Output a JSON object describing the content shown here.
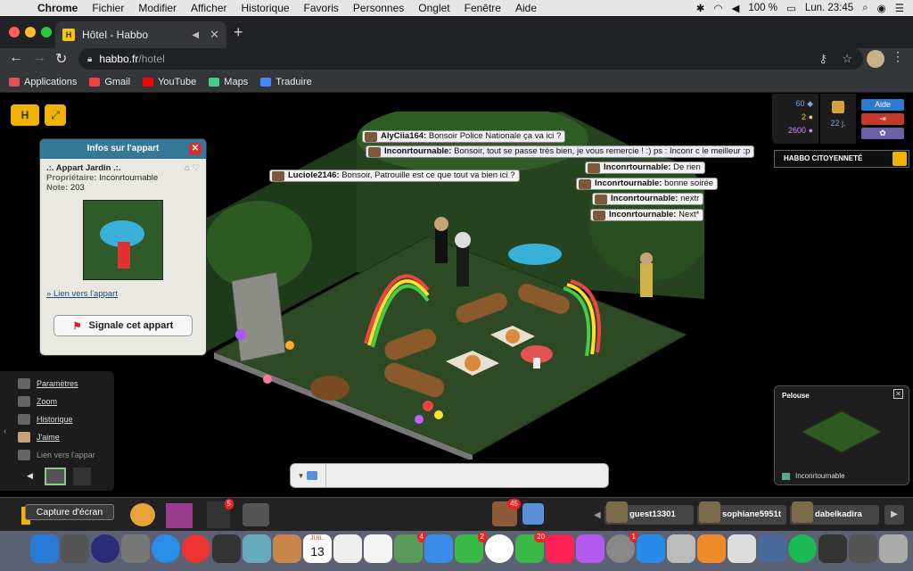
{
  "menubar": {
    "app": "Chrome",
    "items": [
      "Fichier",
      "Modifier",
      "Afficher",
      "Historique",
      "Favoris",
      "Personnes",
      "Onglet",
      "Fenêtre",
      "Aide"
    ],
    "battery": "100 %",
    "clock": "Lun. 23:45"
  },
  "browser": {
    "tab_title": "Hôtel - Habbo",
    "url_host": "habbo.fr",
    "url_path": "/hotel",
    "bookmarks": [
      "Applications",
      "Gmail",
      "YouTube",
      "Maps",
      "Traduire"
    ]
  },
  "room_info": {
    "header": "Infos sur l'appart",
    "name": ".:. Appart Jardin .:.",
    "owner_label": "Propriétaire:",
    "owner": "Inconrtournable",
    "rating_label": "Note:",
    "rating": "203",
    "link": "Lien vers l'appart",
    "report": "Signale cet appart"
  },
  "chat": [
    {
      "user": "AlyCiia164:",
      "text": "Bonsoir Police Nationale ça va ici ?"
    },
    {
      "user": "Inconrtournable:",
      "text": "Bonsoir, tout se passe très bien, je vous remercie ! :) ps : Inconr c le meilleur :p"
    },
    {
      "user": "Inconrtournable:",
      "text": "De rien"
    },
    {
      "user": "Luciole2146:",
      "text": "Bonsoir, Patrouille est ce que tout va bien ici ?"
    },
    {
      "user": "Inconrtournable:",
      "text": "bonne soirée"
    },
    {
      "user": "Inconrtournable:",
      "text": "nextr"
    },
    {
      "user": "Inconrtournable:",
      "text": "Next*"
    }
  ],
  "side_menu": [
    "Paramètres",
    "Zoom",
    "Historique",
    "J'aime",
    "Lien vers l'appar"
  ],
  "currency": {
    "diamonds": "60",
    "credits": "2",
    "duckets": "2600",
    "club_days": "22 j."
  },
  "top_buttons": {
    "help": "Aide"
  },
  "citizenship": "HABBO CITOYENNETÉ",
  "furni_panel": {
    "title": "Pelouse",
    "owner": "Inconrtournable"
  },
  "hotbar": {
    "tooltip": "Capture d'écran",
    "badge_inventory": "5",
    "badge_friends": "45",
    "friends": [
      "guest13301",
      "sophiane5951t",
      "dabelkadira"
    ]
  },
  "dock": {
    "calendar_day": "13",
    "calendar_month": "JUIL.",
    "badges": [
      "4",
      "2",
      "20",
      "1"
    ]
  },
  "colors": {
    "panel_header": "#367897",
    "help_button": "#2d7bd1",
    "logout_button": "#c0392b",
    "settings_button": "#6c5fa8",
    "grass": "#2e4a25"
  }
}
